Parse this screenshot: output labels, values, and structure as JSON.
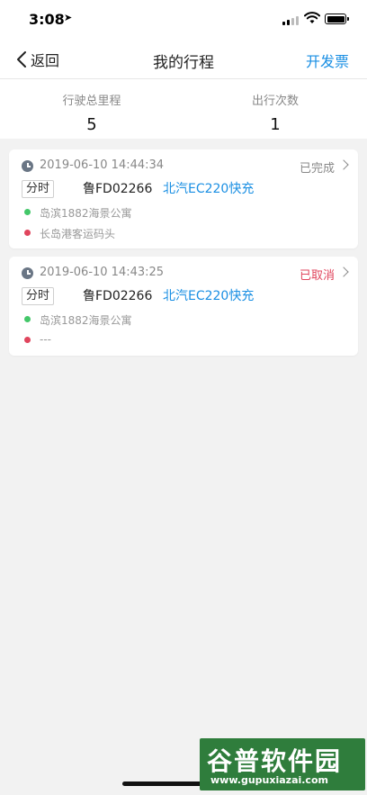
{
  "status_bar": {
    "time": "3:08",
    "location_glyph": "➤"
  },
  "nav": {
    "back_label": "返回",
    "title": "我的行程",
    "action_label": "开发票"
  },
  "stats": [
    {
      "label": "行驶总里程",
      "value": "5"
    },
    {
      "label": "出行次数",
      "value": "1"
    }
  ],
  "trips": [
    {
      "timestamp": "2019-06-10 14:44:34",
      "status": "已完成",
      "tag": "分时",
      "plate": "鲁FD02266",
      "model": "北汽EC220快充",
      "start": "岛滨1882海景公寓",
      "end": "长岛港客运码头"
    },
    {
      "timestamp": "2019-06-10 14:43:25",
      "status": "已取消",
      "tag": "分时",
      "plate": "鲁FD02266",
      "model": "北汽EC220快充",
      "start": "岛滨1882海景公寓",
      "end": "---"
    }
  ],
  "watermark": {
    "name": "谷普软件园",
    "url": "www.gupuxiazai.com"
  },
  "colors": {
    "accent": "#1a8fe3",
    "cancelled": "#e0455d",
    "start_dot": "#43c769",
    "end_dot": "#e0455d",
    "watermark_bg": "#2f7d3c"
  }
}
